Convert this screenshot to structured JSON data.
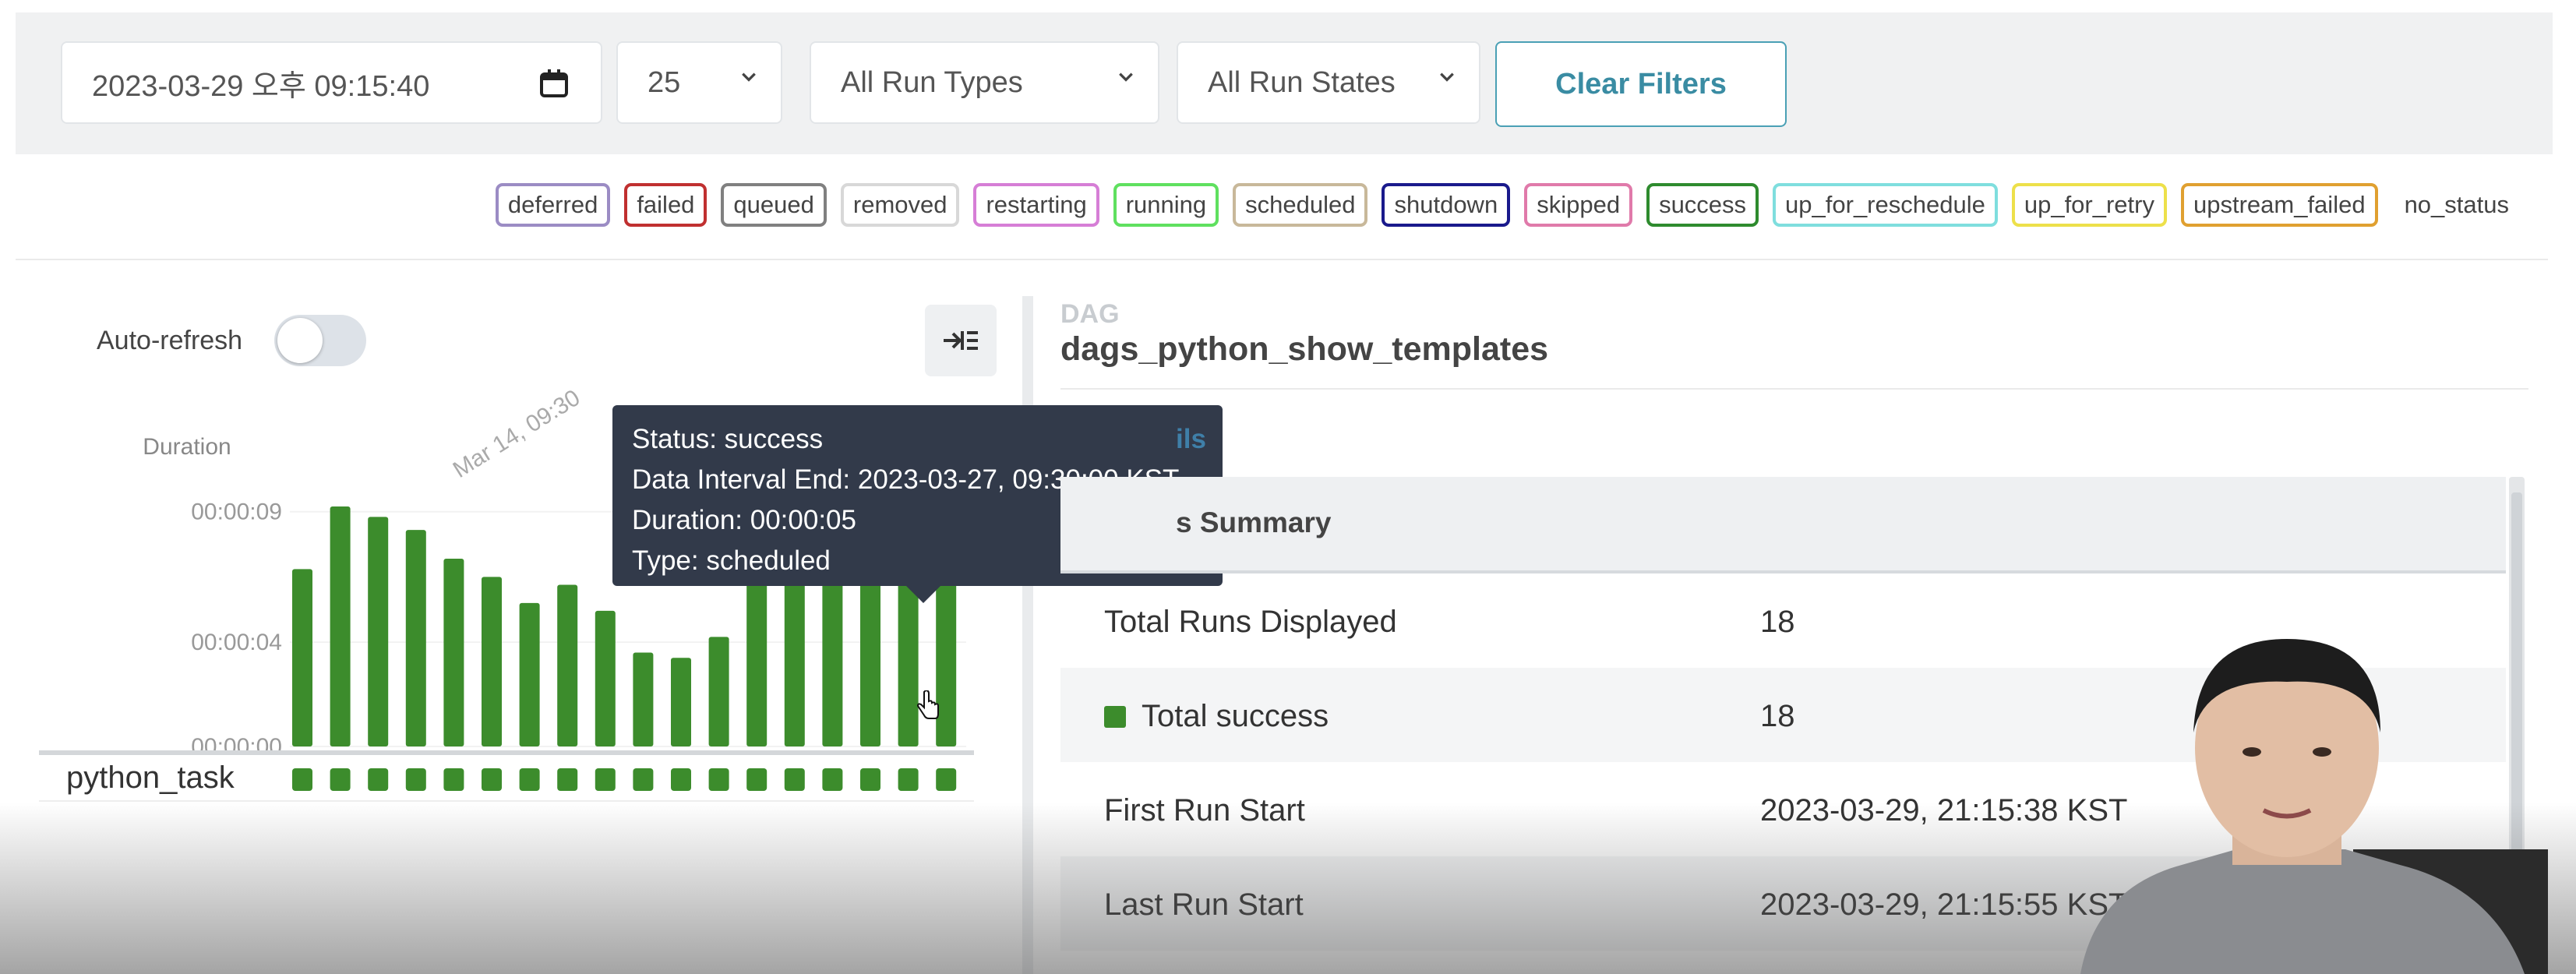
{
  "filters": {
    "datetime": "2023-03-29 오후 09:15:40",
    "page_size": "25",
    "run_type": "All Run Types",
    "run_state": "All Run States",
    "clear_label": "Clear Filters"
  },
  "legend": [
    {
      "label": "deferred",
      "color": "#9b8cc4"
    },
    {
      "label": "failed",
      "color": "#c03030"
    },
    {
      "label": "queued",
      "color": "#808080"
    },
    {
      "label": "removed",
      "color": "#d8d8d8"
    },
    {
      "label": "restarting",
      "color": "#d67ed6"
    },
    {
      "label": "running",
      "color": "#5fe05f"
    },
    {
      "label": "scheduled",
      "color": "#c8b89a"
    },
    {
      "label": "shutdown",
      "color": "#1a1a8c"
    },
    {
      "label": "skipped",
      "color": "#e07aaa"
    },
    {
      "label": "success",
      "color": "#2e8b2e"
    },
    {
      "label": "up_for_reschedule",
      "color": "#7fdede"
    },
    {
      "label": "up_for_retry",
      "color": "#ede04a"
    },
    {
      "label": "upstream_failed",
      "color": "#e0a030"
    },
    {
      "label": "no_status",
      "color": "none"
    }
  ],
  "left_panel": {
    "auto_refresh_label": "Auto-refresh",
    "auto_refresh_on": false,
    "task_name": "python_task"
  },
  "chart_data": {
    "type": "bar",
    "ylabel": "Duration",
    "y_ticks": [
      "00:00:00",
      "00:00:04",
      "00:00:09"
    ],
    "ylim": [
      0,
      9.5
    ],
    "x_annotation": "Mar 14, 09:30",
    "status": "success",
    "bar_color": "#3c8c2c",
    "values": [
      6.8,
      9.2,
      8.8,
      8.3,
      7.2,
      6.5,
      5.5,
      6.2,
      5.2,
      3.6,
      3.4,
      4.2,
      7.3,
      7.0,
      6.6,
      6.8,
      7.2,
      6.5
    ]
  },
  "tooltip": {
    "status": "Status: success",
    "interval_end": "Data Interval End: 2023-03-27, 09:30:00 KST",
    "duration": "Duration: 00:00:05",
    "type": "Type: scheduled"
  },
  "right_panel": {
    "kicker": "DAG",
    "dag_id": "dags_python_show_templates",
    "details_link": "ils",
    "summary_title": "s Summary",
    "rows": [
      {
        "label": "Total Runs Displayed",
        "value": "18"
      },
      {
        "label": "Total success",
        "value": "18"
      },
      {
        "label": "First Run Start",
        "value": "2023-03-29, 21:15:38 KST"
      },
      {
        "label": "Last Run Start",
        "value": "2023-03-29, 21:15:55 KST"
      }
    ]
  }
}
